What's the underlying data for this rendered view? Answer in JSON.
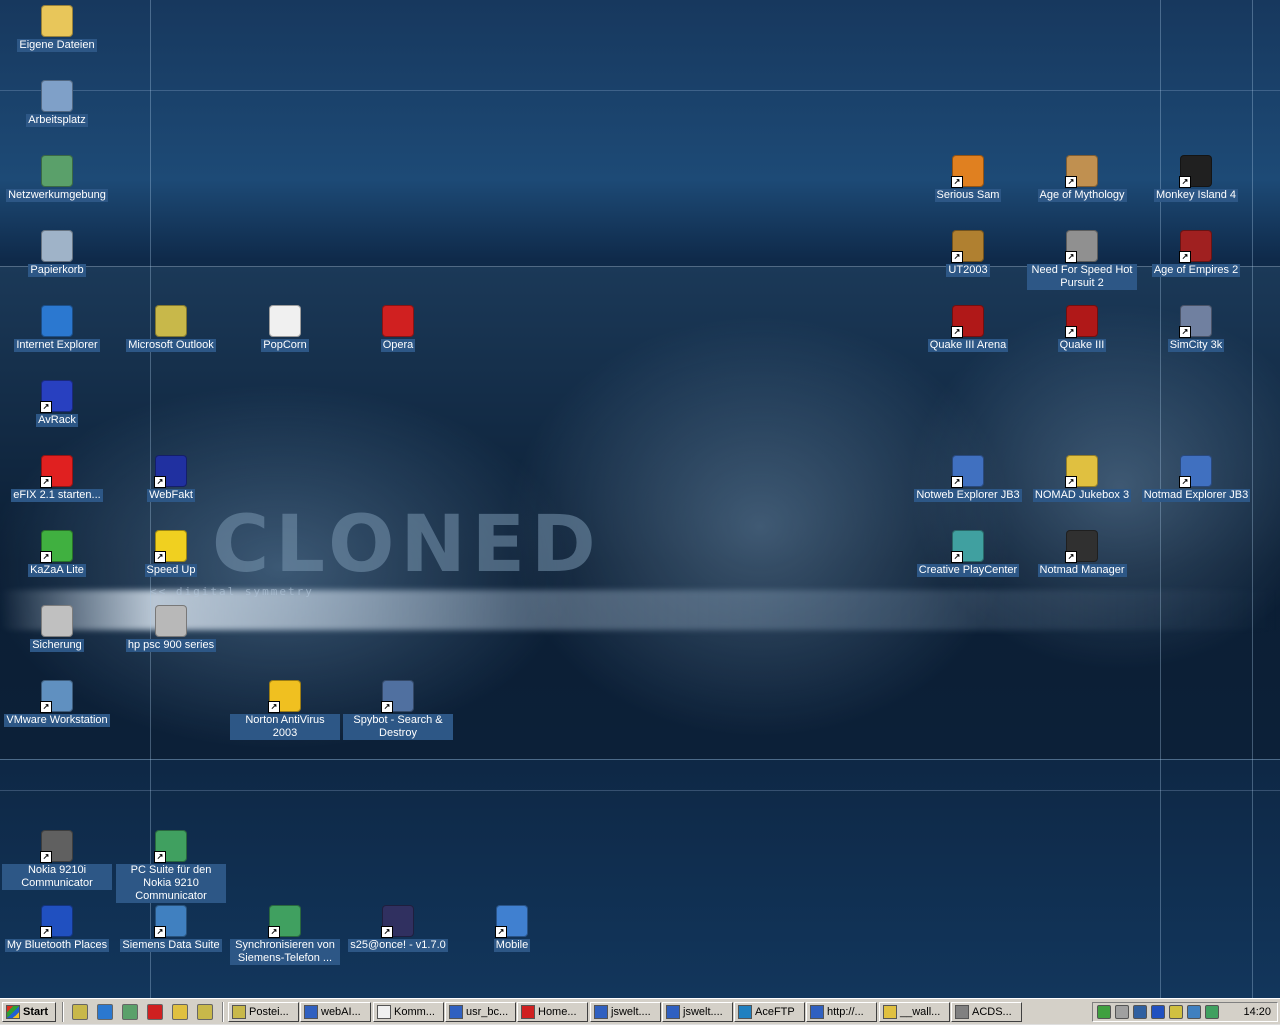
{
  "desktop": {
    "wallpaper_text": "CLONED",
    "wallpaper_subtext": "<< digital symmetry",
    "icons": [
      {
        "label": "Eigene Dateien",
        "icon": "folder-icon",
        "color": "#e8c65a"
      },
      {
        "label": "Arbeitsplatz",
        "icon": "computer-icon",
        "color": "#7fa0c8"
      },
      {
        "label": "Netzwerkumgebung",
        "icon": "network-icon",
        "color": "#5aa06a"
      },
      {
        "label": "Papierkorb",
        "icon": "recycle-bin-icon",
        "color": "#9fb3c8"
      },
      {
        "label": "Internet Explorer",
        "icon": "internet-explorer-icon",
        "color": "#2b78d0"
      },
      {
        "label": "Microsoft Outlook",
        "icon": "outlook-icon",
        "color": "#c8b84a"
      },
      {
        "label": "PopCorn",
        "icon": "popcorn-icon",
        "color": "#f0f0f0"
      },
      {
        "label": "Opera",
        "icon": "opera-icon",
        "color": "#d02020"
      },
      {
        "label": "AvRack",
        "icon": "avrack-icon",
        "color": "#2840c0"
      },
      {
        "label": "eFIX 2.1 starten...",
        "icon": "efix-icon",
        "color": "#e02020"
      },
      {
        "label": "WebFakt",
        "icon": "webfakt-icon",
        "color": "#2030a0"
      },
      {
        "label": "KaZaA Lite",
        "icon": "kazaa-icon",
        "color": "#40b040"
      },
      {
        "label": "Speed Up",
        "icon": "speed-up-icon",
        "color": "#f0d020"
      },
      {
        "label": "Sicherung",
        "icon": "backup-icon",
        "color": "#c0c0c0"
      },
      {
        "label": "hp psc 900 series",
        "icon": "printer-icon",
        "color": "#b8b8b8"
      },
      {
        "label": "VMware Workstation",
        "icon": "vmware-icon",
        "color": "#6090c0"
      },
      {
        "label": "Norton AntiVirus 2003",
        "icon": "norton-icon",
        "color": "#f0c020"
      },
      {
        "label": "Spybot - Search & Destroy",
        "icon": "spybot-icon",
        "color": "#5070a0"
      },
      {
        "label": "Serious Sam",
        "icon": "serious-sam-icon",
        "color": "#e08020"
      },
      {
        "label": "Age of Mythology",
        "icon": "age-of-mythology-icon",
        "color": "#c09050"
      },
      {
        "label": "Monkey Island 4",
        "icon": "monkey-island-icon",
        "color": "#202020"
      },
      {
        "label": "UT2003",
        "icon": "ut2003-icon",
        "color": "#b08030"
      },
      {
        "label": "Need For Speed Hot Pursuit 2",
        "icon": "nfs-icon",
        "color": "#909090"
      },
      {
        "label": "Age of Empires 2",
        "icon": "age-of-empires-icon",
        "color": "#a02020"
      },
      {
        "label": "Quake III Arena",
        "icon": "quake-arena-icon",
        "color": "#b01818"
      },
      {
        "label": "Quake III",
        "icon": "quake-icon",
        "color": "#b01818"
      },
      {
        "label": "SimCity 3k",
        "icon": "simcity-icon",
        "color": "#7080a0"
      },
      {
        "label": "Notweb Explorer JB3",
        "icon": "notweb-icon",
        "color": "#4070c0"
      },
      {
        "label": "NOMAD Jukebox 3",
        "icon": "nomad-icon",
        "color": "#e0c040"
      },
      {
        "label": "Notmad Explorer JB3",
        "icon": "notmad-icon",
        "color": "#4070c0"
      },
      {
        "label": "Creative PlayCenter",
        "icon": "playcenter-icon",
        "color": "#40a0a0"
      },
      {
        "label": "Notmad Manager",
        "icon": "notmad-manager-icon",
        "color": "#303030"
      },
      {
        "label": "Nokia 9210i Communicator",
        "icon": "nokia-icon",
        "color": "#606060"
      },
      {
        "label": "PC Suite für den Nokia 9210 Communicator",
        "icon": "pc-suite-icon",
        "color": "#40a060"
      },
      {
        "label": "My Bluetooth Places",
        "icon": "bluetooth-icon",
        "color": "#2050c0"
      },
      {
        "label": "Siemens Data Suite",
        "icon": "siemens-icon",
        "color": "#4080c0"
      },
      {
        "label": "Synchronisieren von Siemens-Telefon ...",
        "icon": "sync-icon",
        "color": "#40a060"
      },
      {
        "label": "s25@once! - v1.7.0",
        "icon": "s25-icon",
        "color": "#303060"
      },
      {
        "label": "Mobile",
        "icon": "mobile-icon",
        "color": "#4080d0"
      }
    ]
  },
  "taskbar": {
    "start_label": "Start",
    "quick_launch": [
      "outlook-icon",
      "internet-explorer-icon",
      "network-icon",
      "opera-icon",
      "search-icon",
      "outlook-icon"
    ],
    "tasks": [
      {
        "label": "Postei...",
        "icon": "outlook-icon"
      },
      {
        "label": "webAI...",
        "icon": "word-icon"
      },
      {
        "label": "Komm...",
        "icon": "document-icon"
      },
      {
        "label": "usr_bc...",
        "icon": "word-icon"
      },
      {
        "label": "Home...",
        "icon": "opera-icon"
      },
      {
        "label": "jswelt....",
        "icon": "word-icon"
      },
      {
        "label": "jswelt....",
        "icon": "word-icon"
      },
      {
        "label": "AceFTP",
        "icon": "ftp-icon"
      },
      {
        "label": "http://...",
        "icon": "word-icon"
      },
      {
        "label": "__wall...",
        "icon": "search-icon"
      },
      {
        "label": "ACDS...",
        "icon": "image-icon"
      }
    ],
    "tray_icons": [
      "network-tray-icon",
      "volume-icon",
      "vmware-tray-icon",
      "bluetooth-tray-icon",
      "antivirus-tray-icon",
      "monitor-tray-icon",
      "calendar-tray-icon"
    ],
    "clock": "14:20"
  }
}
